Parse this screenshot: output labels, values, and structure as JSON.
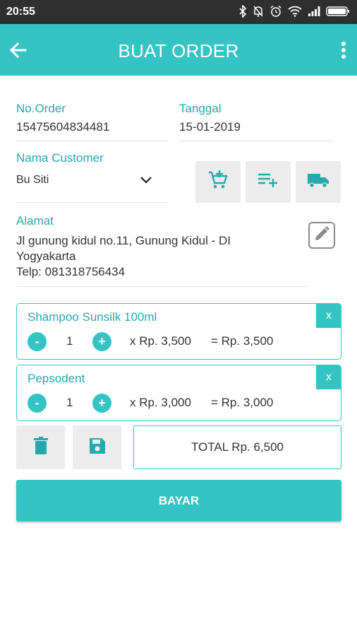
{
  "status_bar": {
    "time": "20:55"
  },
  "app_bar": {
    "title": "BUAT ORDER"
  },
  "order": {
    "no_label": "No.Order",
    "no_value": "15475604834481",
    "date_label": "Tanggal",
    "date_value": "15-01-2019"
  },
  "customer": {
    "label": "Nama Customer",
    "value": "Bu Siti"
  },
  "address": {
    "label": "Alamat",
    "line1": "Jl gunung kidul no.11, Gunung Kidul - DI",
    "line2": "Yogyakarta",
    "line3": "Telp: 081318756434"
  },
  "items": [
    {
      "name": "Shampoo Sunsilk 100ml",
      "qty": "1",
      "price": "x Rp. 3,500",
      "subtotal": "= Rp. 3,500",
      "remove": "x",
      "minus": "-",
      "plus": "+"
    },
    {
      "name": "Pepsodent",
      "qty": "1",
      "price": "x Rp. 3,000",
      "subtotal": "= Rp. 3,000",
      "remove": "x",
      "minus": "-",
      "plus": "+"
    }
  ],
  "total": "TOTAL Rp. 6,500",
  "pay_button": "BAYAR",
  "colors": {
    "accent": "#35c4c4",
    "label": "#26a9ad",
    "status_bar": "#2f2f2f"
  },
  "icons": [
    "back-arrow-icon",
    "more-vert-icon",
    "add-cart-icon",
    "playlist-add-icon",
    "truck-icon",
    "edit-pencil-icon",
    "trash-icon",
    "save-floppy-icon",
    "chevron-down-icon"
  ]
}
